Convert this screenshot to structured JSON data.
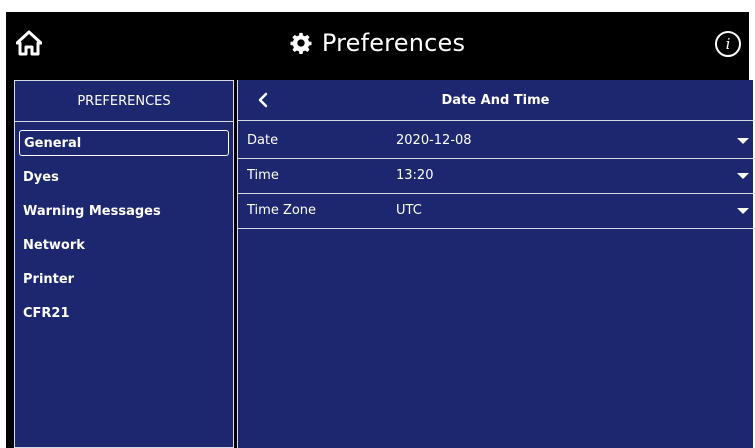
{
  "header": {
    "title": "Preferences",
    "home_icon": "home-icon",
    "settings_icon": "gear-icon",
    "info_icon": "info-icon",
    "info_glyph": "i"
  },
  "sidebar": {
    "title": "PREFERENCES",
    "items": [
      {
        "label": "General",
        "selected": true
      },
      {
        "label": "Dyes",
        "selected": false
      },
      {
        "label": "Warning Messages",
        "selected": false
      },
      {
        "label": "Network",
        "selected": false
      },
      {
        "label": "Printer",
        "selected": false
      },
      {
        "label": "CFR21",
        "selected": false
      }
    ]
  },
  "panel": {
    "title": "Date And Time",
    "back_icon": "chevron-left-icon",
    "rows": [
      {
        "label": "Date",
        "value": "2020-12-08"
      },
      {
        "label": "Time",
        "value": "13:20"
      },
      {
        "label": "Time Zone",
        "value": "UTC"
      }
    ]
  },
  "colors": {
    "background": "#000000",
    "panel": "#1c2770",
    "divider": "#d7d9e6",
    "text": "#ffffff"
  }
}
